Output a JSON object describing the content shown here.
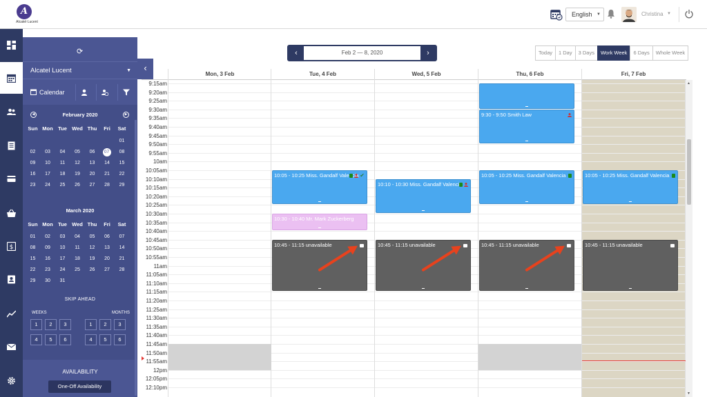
{
  "brand": {
    "logo_letter": "A",
    "logo_text": "Alcatel·Lucent"
  },
  "topbar": {
    "language": "English",
    "user_name": "Christina"
  },
  "sidebar_panel": {
    "account": "Alcatel Lucent",
    "calendar_label": "Calendar",
    "months": [
      {
        "title": "February 2020",
        "dow": [
          "Sun",
          "Mon",
          "Tue",
          "Wed",
          "Thu",
          "Fri",
          "Sat"
        ],
        "weeks": [
          [
            "",
            "",
            "",
            "",
            "",
            "",
            "01"
          ],
          [
            "02",
            "03",
            "04",
            "05",
            "06",
            "07",
            "08"
          ],
          [
            "09",
            "10",
            "11",
            "12",
            "13",
            "14",
            "15"
          ],
          [
            "16",
            "17",
            "18",
            "19",
            "20",
            "21",
            "22"
          ],
          [
            "23",
            "24",
            "25",
            "26",
            "27",
            "28",
            "29"
          ]
        ],
        "today": "07"
      },
      {
        "title": "March 2020",
        "dow": [
          "Sun",
          "Mon",
          "Tue",
          "Wed",
          "Thu",
          "Fri",
          "Sat"
        ],
        "weeks": [
          [
            "01",
            "02",
            "03",
            "04",
            "05",
            "06",
            "07"
          ],
          [
            "08",
            "09",
            "10",
            "11",
            "12",
            "13",
            "14"
          ],
          [
            "15",
            "16",
            "17",
            "18",
            "19",
            "20",
            "21"
          ],
          [
            "22",
            "23",
            "24",
            "25",
            "26",
            "27",
            "28"
          ],
          [
            "29",
            "30",
            "31",
            "",
            "",
            "",
            ""
          ]
        ]
      }
    ],
    "skip_ahead_title": "SKIP AHEAD",
    "weeks_label": "WEEKS",
    "months_label": "MONTHS",
    "skip_numbers": [
      "1",
      "2",
      "3",
      "4",
      "5",
      "6"
    ],
    "availability_title": "AVAILABILITY",
    "oneoff_button": "One-Off Availability"
  },
  "toolbar": {
    "date_range": "Feb 2 — 8, 2020",
    "prev_icon": "chevron-left-icon",
    "next_icon": "chevron-right-icon",
    "views": [
      "Today",
      "1 Day",
      "3 Days",
      "Work Week",
      "6 Days",
      "Whole Week"
    ],
    "active_view": "Work Week"
  },
  "calendar": {
    "day_headers": [
      "Mon, 3 Feb",
      "Tue, 4 Feb",
      "Wed, 5 Feb",
      "Thu, 6 Feb",
      "Fri, 7 Feb"
    ],
    "time_labels": [
      "9:15am",
      "9:20am",
      "9:25am",
      "9:30am",
      "9:35am",
      "9:40am",
      "9:45am",
      "9:50am",
      "9:55am",
      "10am",
      "10:05am",
      "10:10am",
      "10:15am",
      "10:20am",
      "10:25am",
      "10:30am",
      "10:35am",
      "10:40am",
      "10:45am",
      "10:50am",
      "10:55am",
      "11am",
      "11:05am",
      "11:10am",
      "11:15am",
      "11:20am",
      "11:25am",
      "11:30am",
      "11:35am",
      "11:40am",
      "11:45am",
      "11:50am",
      "11:55am",
      "12pm",
      "12:05pm",
      "12:10pm"
    ],
    "events": [
      {
        "day": 3,
        "start": 0,
        "end": 3,
        "text": "",
        "color": "blue"
      },
      {
        "day": 3,
        "start": 3,
        "end": 7,
        "text": "9:30 - 9:50 Smith Law",
        "color": "blue",
        "icons": [
          "person"
        ]
      },
      {
        "day": 1,
        "start": 10,
        "end": 14,
        "text": "10:05 - 10:25 Miss. Gandalf Valencia",
        "color": "blue",
        "icons": [
          "trash",
          "person",
          "check"
        ]
      },
      {
        "day": 2,
        "start": 11,
        "end": 15,
        "text": "10:10 - 10:30 Miss. Gandalf Valencia",
        "color": "blue",
        "icons": [
          "trash",
          "person"
        ]
      },
      {
        "day": 3,
        "start": 10,
        "end": 14,
        "text": "10:05 - 10:25 Miss. Gandalf Valencia",
        "color": "blue",
        "icons": [
          "trash"
        ]
      },
      {
        "day": 4,
        "start": 10,
        "end": 14,
        "text": "10:05 - 10:25 Miss. Gandalf Valencia",
        "color": "blue",
        "icons": [
          "trash"
        ]
      },
      {
        "day": 1,
        "start": 15,
        "end": 17,
        "text": "10:30 - 10:40 Mr. Mark Zuckerberg",
        "color": "pink"
      },
      {
        "day": 1,
        "start": 18,
        "end": 24,
        "text": "10:45 - 11:15 unavailable",
        "color": "dark",
        "icons": [
          "cal"
        ]
      },
      {
        "day": 2,
        "start": 18,
        "end": 24,
        "text": "10:45 - 11:15 unavailable",
        "color": "dark",
        "icons": [
          "cal"
        ]
      },
      {
        "day": 3,
        "start": 18,
        "end": 24,
        "text": "10:45 - 11:15 unavailable",
        "color": "dark",
        "icons": [
          "cal"
        ]
      },
      {
        "day": 4,
        "start": 18,
        "end": 24,
        "text": "10:45 - 11:15 unavailable",
        "color": "dark",
        "icons": [
          "cal"
        ]
      }
    ],
    "unavailable_blocks": [
      {
        "day": 0,
        "start": 30,
        "end": 33
      },
      {
        "day": 3,
        "start": 30,
        "end": 33
      }
    ],
    "arrow_days": [
      1,
      2,
      3
    ]
  },
  "colors": {
    "rail": "#2e3a63",
    "panel": "#4b5693",
    "event_blue": "#4aa8ef",
    "event_dark": "#606060",
    "event_pink": "#ebc0f2",
    "annotation_arrow": "#e8421d"
  }
}
